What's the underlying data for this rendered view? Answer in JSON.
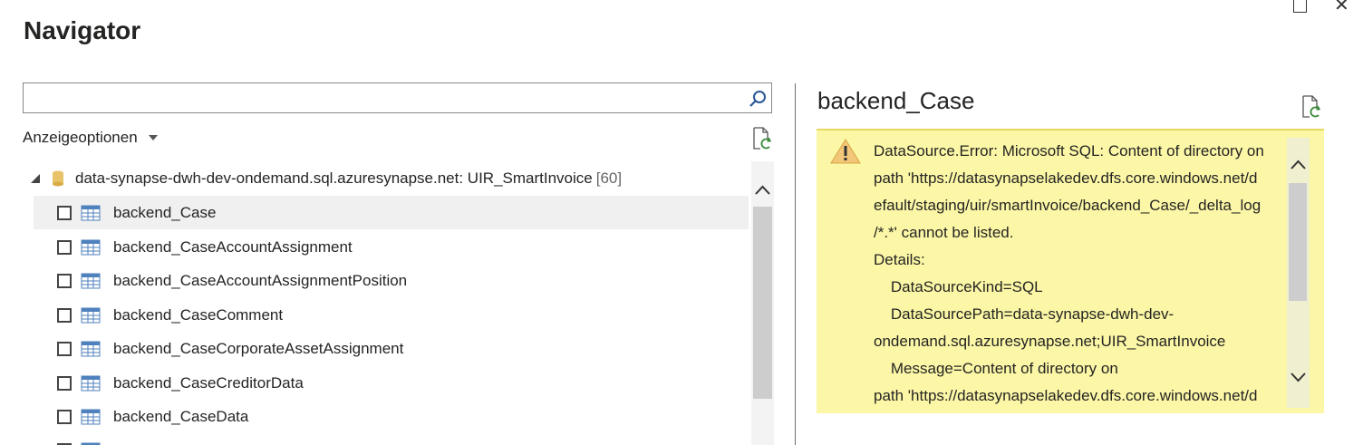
{
  "window": {
    "title": "Navigator"
  },
  "search": {
    "value": "",
    "placeholder": ""
  },
  "display_options": {
    "label": "Anzeigeoptionen"
  },
  "tree": {
    "root": {
      "label": "data-synapse-dwh-dev-ondemand.sql.azuresynapse.net: UIR_SmartInvoice",
      "count": "[60]"
    },
    "items": [
      {
        "label": "backend_Case",
        "selected": true
      },
      {
        "label": "backend_CaseAccountAssignment"
      },
      {
        "label": "backend_CaseAccountAssignmentPosition"
      },
      {
        "label": "backend_CaseComment"
      },
      {
        "label": "backend_CaseCorporateAssetAssignment"
      },
      {
        "label": "backend_CaseCreditorData"
      },
      {
        "label": "backend_CaseData"
      }
    ]
  },
  "preview": {
    "title": "backend_Case",
    "error_lines": [
      "DataSource.Error: Microsoft SQL: Content of directory on",
      "path 'https://datasynapselakedev.dfs.core.windows.net/d",
      "efault/staging/uir/smartInvoice/backend_Case/_delta_log",
      "/*.*' cannot be listed.",
      "Details:",
      "    DataSourceKind=SQL",
      "    DataSourcePath=data-synapse-dwh-dev-",
      "ondemand.sql.azuresynapse.net;UIR_SmartInvoice",
      "    Message=Content of directory on",
      "path 'https://datasynapselakedev.dfs.core.windows.net/d"
    ]
  },
  "colors": {
    "error_background": "#fbf7a6",
    "accent": "#4f81bd"
  }
}
